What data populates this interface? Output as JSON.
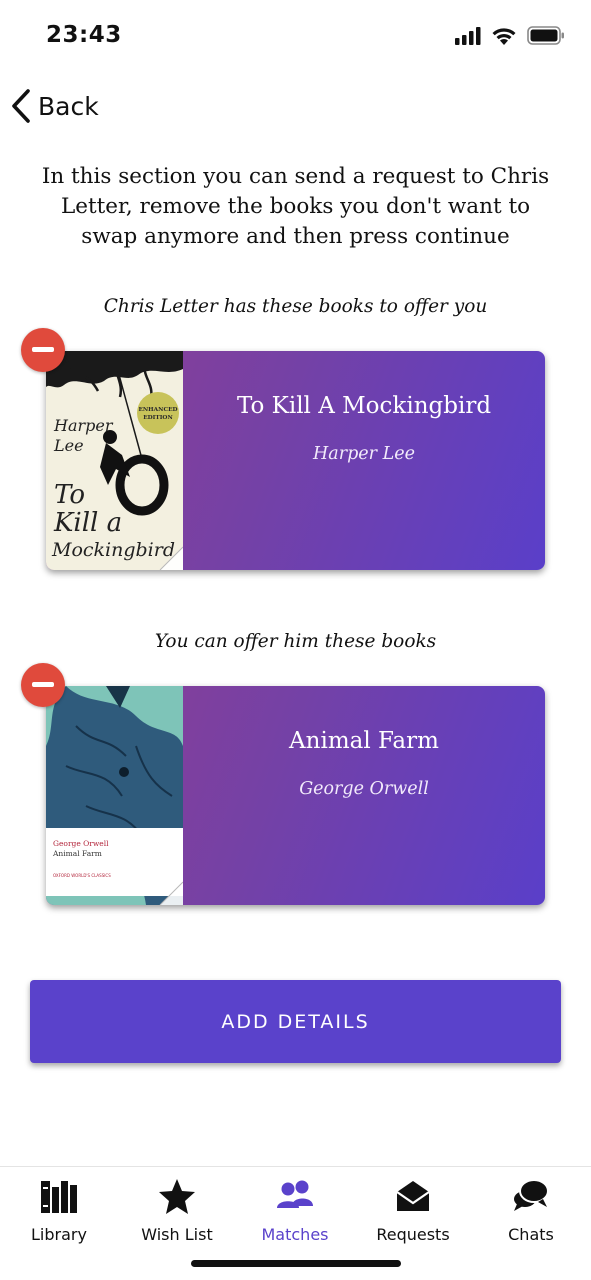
{
  "status_bar": {
    "time": "23:43"
  },
  "nav": {
    "back_label": "Back"
  },
  "intro": {
    "text": "In this section you can send a request to  Chris Letter, remove the books you don't want to swap anymore and then press continue"
  },
  "offered_section": {
    "heading": "Chris Letter has these books to offer you",
    "books": [
      {
        "title": "To Kill A Mockingbird",
        "author": "Harper Lee",
        "cover_lines": [
          "Harper",
          "Lee",
          "To",
          "Kill a",
          "Mockingbird"
        ],
        "cover_badge": [
          "ENHANCED",
          "EDITION"
        ]
      }
    ]
  },
  "your_section": {
    "heading": "You can offer him these books",
    "books": [
      {
        "title": "Animal Farm",
        "author": "George Orwell",
        "cover_lines": [
          "George Orwell",
          "Animal Farm"
        ],
        "cover_series": "OXFORD WORLD'S CLASSICS"
      }
    ]
  },
  "actions": {
    "add_details_label": "ADD DETAILS"
  },
  "tab_bar": {
    "tabs": [
      {
        "label": "Library",
        "icon": "library-icon"
      },
      {
        "label": "Wish List",
        "icon": "star-icon"
      },
      {
        "label": "Matches",
        "icon": "people-icon",
        "active": true
      },
      {
        "label": "Requests",
        "icon": "envelope-icon"
      },
      {
        "label": "Chats",
        "icon": "chat-bubbles-icon"
      }
    ]
  },
  "colors": {
    "accent": "#5a42cb",
    "remove": "#e04a3c",
    "card_gradient_start": "#8e3f93",
    "card_gradient_end": "#5a3fc9"
  }
}
